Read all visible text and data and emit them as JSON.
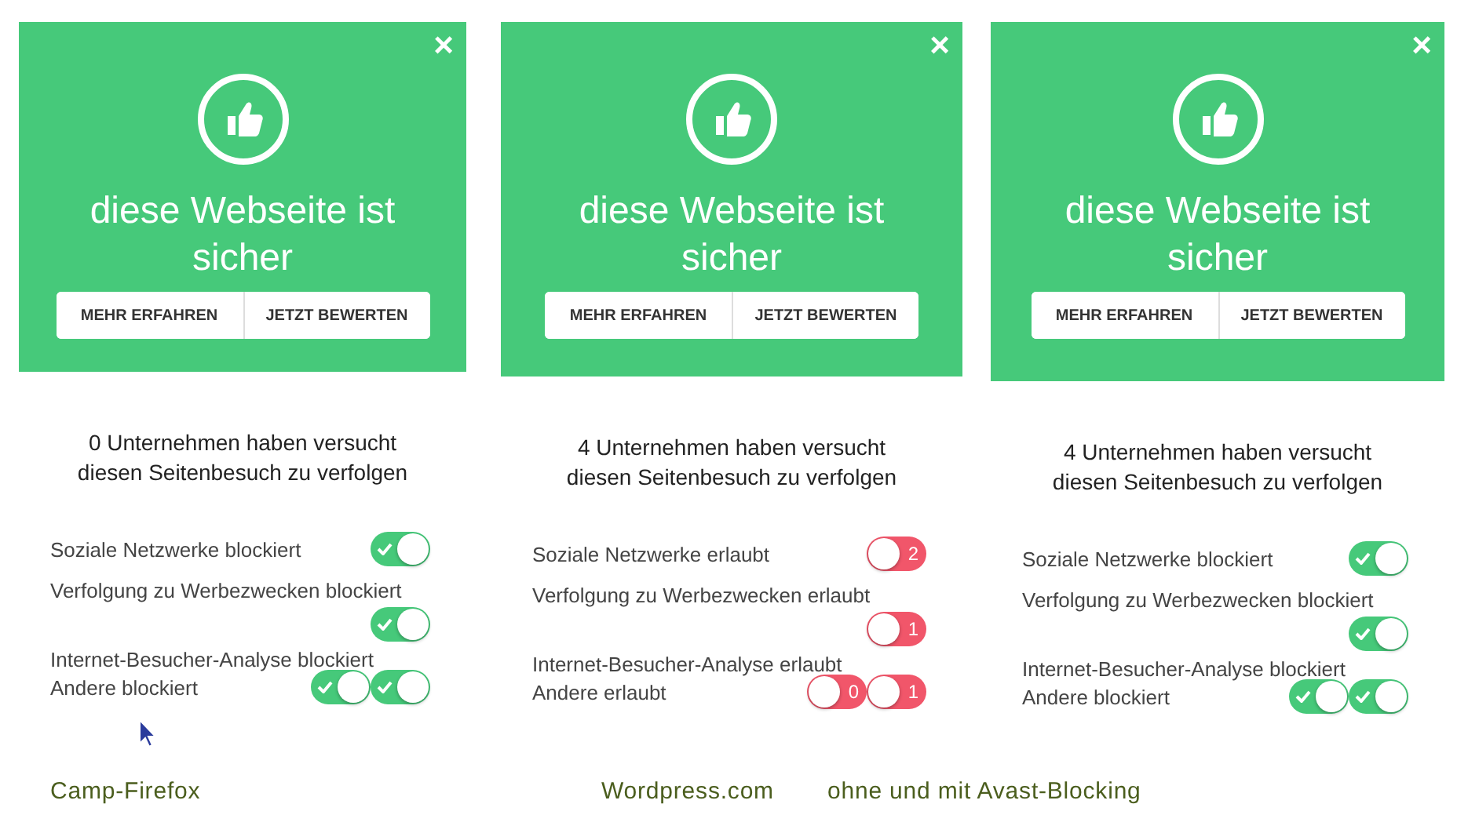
{
  "panels": [
    {
      "close": "×",
      "title": "diese Webseite ist sicher",
      "buttons": [
        "MEHR ERFAHREN",
        "JETZT BEWERTEN"
      ],
      "summary": "0 Unternehmen haben versucht diesen Seitenbesuch zu verfolgen",
      "settings": [
        {
          "label": "Soziale Netzwerke blockiert",
          "on": true
        },
        {
          "label": "Verfolgung zu Werbezwecken blockiert",
          "on": true
        },
        {
          "label": "Internet-Besucher-Analyse blockiert",
          "on": true
        },
        {
          "label": "Andere blockiert",
          "on": true
        }
      ]
    },
    {
      "close": "×",
      "title": "diese Webseite ist sicher",
      "buttons": [
        "MEHR ERFAHREN",
        "JETZT BEWERTEN"
      ],
      "summary": "4 Unternehmen haben versucht diesen Seitenbesuch zu verfolgen",
      "settings": [
        {
          "label": "Soziale Netzwerke erlaubt",
          "on": false,
          "count": "2"
        },
        {
          "label": "Verfolgung zu Werbezwecken erlaubt",
          "on": false,
          "count": "1"
        },
        {
          "label": "Internet-Besucher-Analyse erlaubt",
          "on": false,
          "count": "0"
        },
        {
          "label": "Andere erlaubt",
          "on": false,
          "count": "1"
        }
      ]
    },
    {
      "close": "×",
      "title": "diese Webseite ist sicher",
      "buttons": [
        "MEHR ERFAHREN",
        "JETZT BEWERTEN"
      ],
      "summary": "4 Unternehmen haben versucht diesen Seitenbesuch zu verfolgen",
      "settings": [
        {
          "label": "Soziale Netzwerke blockiert",
          "on": true
        },
        {
          "label": "Verfolgung zu Werbezwecken blockiert",
          "on": true
        },
        {
          "label": "Internet-Besucher-Analyse blockiert",
          "on": true
        },
        {
          "label": "Andere blockiert",
          "on": true
        }
      ]
    }
  ],
  "captions": [
    "Camp-Firefox",
    "Wordpress.com",
    "ohne und mit Avast-Blocking"
  ]
}
